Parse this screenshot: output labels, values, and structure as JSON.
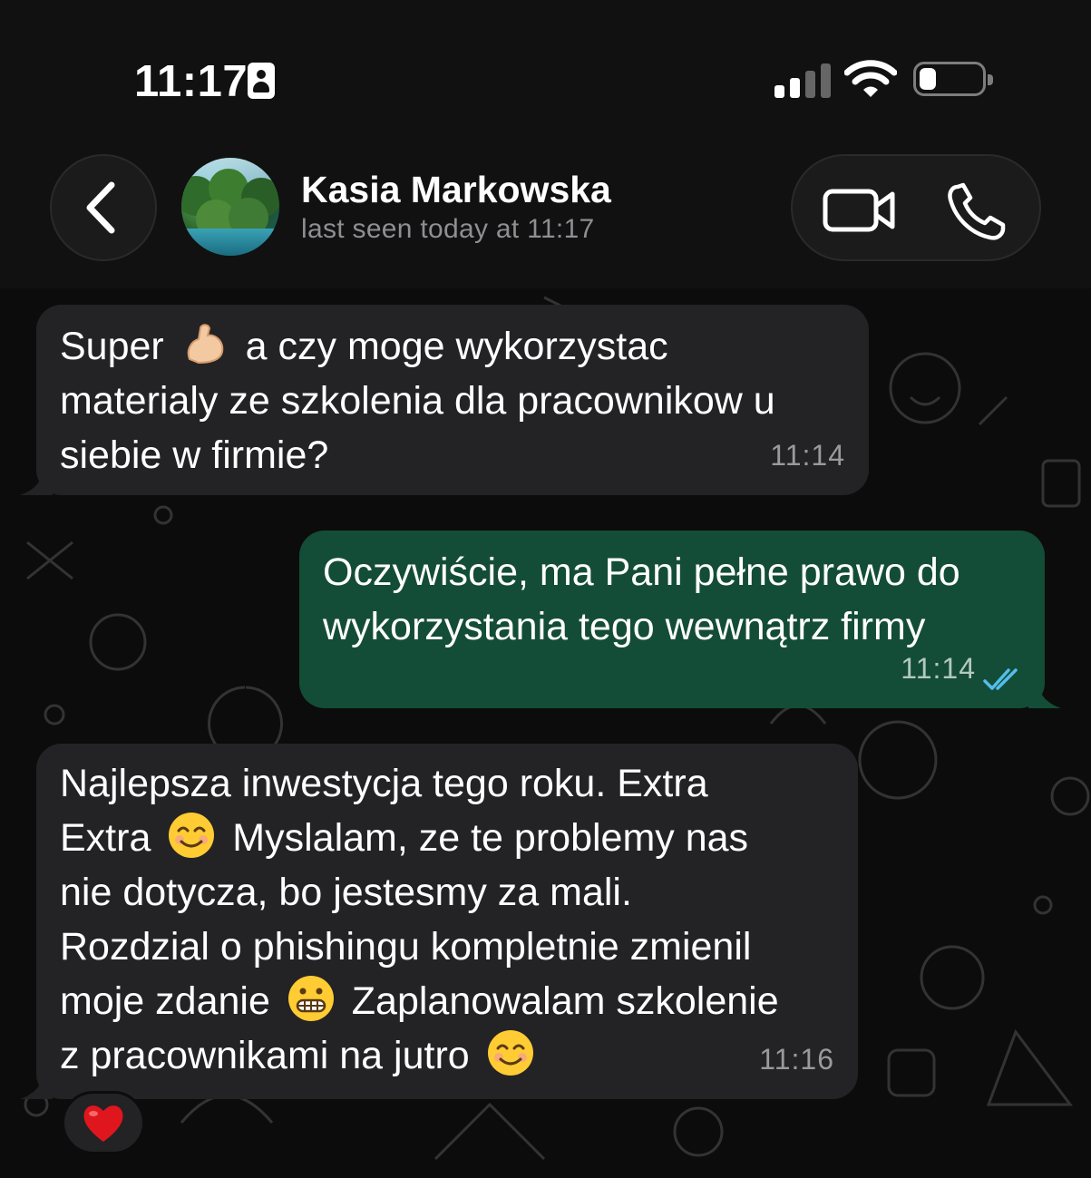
{
  "status": {
    "time": "11:17",
    "icons": [
      "contact-card-icon",
      "cellular-signal-icon",
      "wifi-icon",
      "battery-icon"
    ]
  },
  "header": {
    "contact_name": "Kasia Markowska",
    "last_seen": "last seen today at 11:17",
    "icons": [
      "back-chevron-icon",
      "video-camera-icon",
      "phone-icon"
    ]
  },
  "messages": [
    {
      "direction": "incoming",
      "line1_pre": "Super",
      "line1_post": "a czy moge wykorzystac",
      "line2": "materialy ze szkolenia dla pracownikow u",
      "line3": "siebie w firmie?",
      "emoji": "flexed-biceps-emoji",
      "time": "11:14"
    },
    {
      "direction": "outgoing",
      "line1": "Oczywiście, ma Pani pełne prawo do",
      "line2": "wykorzystania tego wewnątrz firmy",
      "time": "11:14",
      "status_icon": "double-check-read-icon"
    },
    {
      "direction": "incoming",
      "line1": "Najlepsza inwestycja tego roku. Extra",
      "line2_pre": "Extra",
      "line2_post": "Myslalam, ze te problemy nas",
      "line3": "nie dotycza, bo jestesmy za mali.",
      "line4": "Rozdzial o phishingu kompletnie zmienil",
      "line5_pre": "moje zdanie",
      "line5_post": "Zaplanowalam szkolenie",
      "line6": "z pracownikami na jutro",
      "emojis": [
        "smiling-face-emoji",
        "grimacing-face-emoji",
        "smiling-face-emoji"
      ],
      "time": "11:16",
      "reaction": "red-heart-emoji"
    }
  ],
  "colors": {
    "background": "#0b0b0b",
    "incoming_bubble": "#232325",
    "outgoing_bubble": "#144d37",
    "read_check": "#53bdeb",
    "timestamp": "#9a9a9a"
  }
}
